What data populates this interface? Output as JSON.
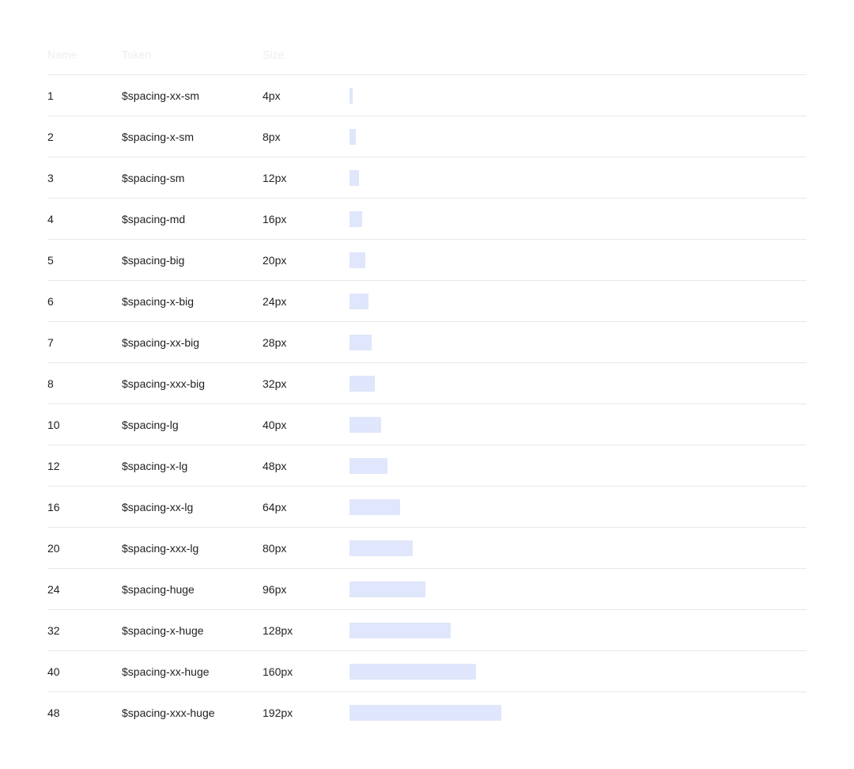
{
  "header": {
    "name": "Name",
    "token": "Token",
    "size": "Size"
  },
  "colors": {
    "bar": "#e0e6fb",
    "divider": "#e8e8ec",
    "text": "#1f1f24"
  },
  "rows": [
    {
      "name": "1",
      "token": "$spacing-xx-sm",
      "size": "4px",
      "value": 4
    },
    {
      "name": "2",
      "token": "$spacing-x-sm",
      "size": "8px",
      "value": 8
    },
    {
      "name": "3",
      "token": "$spacing-sm",
      "size": "12px",
      "value": 12
    },
    {
      "name": "4",
      "token": "$spacing-md",
      "size": "16px",
      "value": 16
    },
    {
      "name": "5",
      "token": "$spacing-big",
      "size": "20px",
      "value": 20
    },
    {
      "name": "6",
      "token": "$spacing-x-big",
      "size": "24px",
      "value": 24
    },
    {
      "name": "7",
      "token": "$spacing-xx-big",
      "size": "28px",
      "value": 28
    },
    {
      "name": "8",
      "token": "$spacing-xxx-big",
      "size": "32px",
      "value": 32
    },
    {
      "name": "10",
      "token": "$spacing-lg",
      "size": "40px",
      "value": 40
    },
    {
      "name": "12",
      "token": "$spacing-x-lg",
      "size": "48px",
      "value": 48
    },
    {
      "name": "16",
      "token": "$spacing-xx-lg",
      "size": "64px",
      "value": 64
    },
    {
      "name": "20",
      "token": "$spacing-xxx-lg",
      "size": "80px",
      "value": 80
    },
    {
      "name": "24",
      "token": "$spacing-huge",
      "size": "96px",
      "value": 96
    },
    {
      "name": "32",
      "token": "$spacing-x-huge",
      "size": "128px",
      "value": 128
    },
    {
      "name": "40",
      "token": "$spacing-xx-huge",
      "size": "160px",
      "value": 160
    },
    {
      "name": "48",
      "token": "$spacing-xxx-huge",
      "size": "192px",
      "value": 192
    }
  ]
}
